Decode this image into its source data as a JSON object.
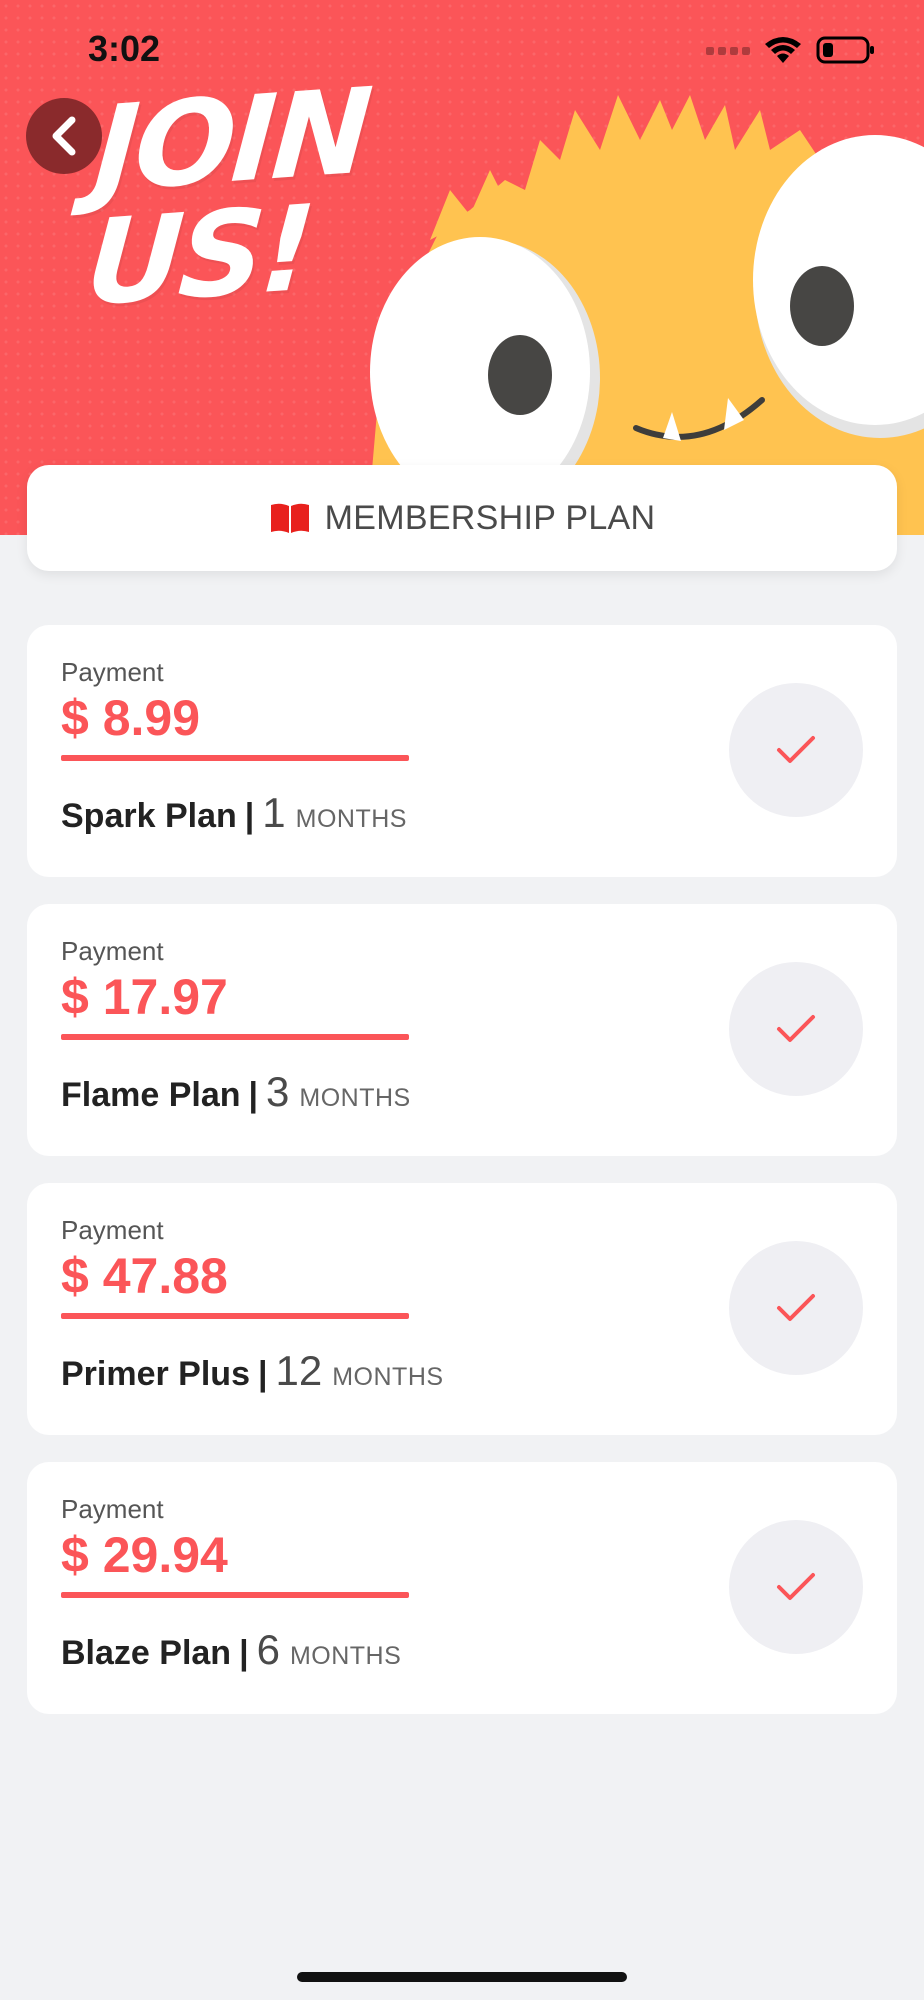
{
  "status_bar": {
    "time": "3:02"
  },
  "hero": {
    "title": "JOIN US!"
  },
  "header": {
    "label": "MEMBERSHIP PLAN",
    "icon": "book-icon"
  },
  "colors": {
    "accent": "#fb5558",
    "monster": "#ffc350",
    "background": "#f1f2f4"
  },
  "plans": [
    {
      "payment_label": "Payment",
      "price": "$ 8.99",
      "name": "Spark Plan",
      "separator": "|",
      "months": "1",
      "months_label": "MONTHS"
    },
    {
      "payment_label": "Payment",
      "price": "$ 17.97",
      "name": "Flame Plan",
      "separator": "|",
      "months": "3",
      "months_label": "MONTHS"
    },
    {
      "payment_label": "Payment",
      "price": "$ 47.88",
      "name": "Primer Plus",
      "separator": "|",
      "months": "12",
      "months_label": "MONTHS"
    },
    {
      "payment_label": "Payment",
      "price": "$ 29.94",
      "name": "Blaze Plan",
      "separator": "|",
      "months": "6",
      "months_label": "MONTHS"
    }
  ]
}
